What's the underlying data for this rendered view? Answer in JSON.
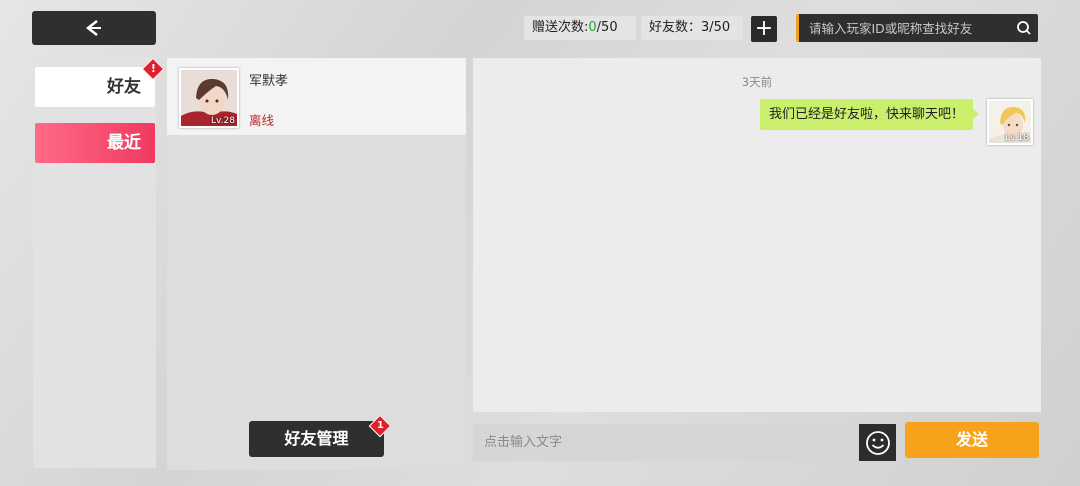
{
  "header": {
    "gift_label": "赠送次数:",
    "gift_used": "0",
    "gift_total": "/50",
    "friend_count": "好友数：3/50",
    "add_symbol": "+",
    "search_placeholder": "请输入玩家ID或昵称查找好友"
  },
  "tabs": {
    "friends_label": "好友",
    "recent_label": "最近",
    "friends_badge": "!"
  },
  "friend_list": [
    {
      "name": "军默孝",
      "status": "离线",
      "level": "Lv.28"
    }
  ],
  "manage": {
    "label": "好友管理",
    "badge": "1"
  },
  "chat": {
    "time_label": "3天前",
    "message": "我们已经是好友啦，快来聊天吧！",
    "self_level": "Lv.18"
  },
  "input": {
    "placeholder": "点击输入文字",
    "send_label": "发送"
  },
  "colors": {
    "accent_pink": "#f03a60",
    "accent_orange": "#f7a21b",
    "bubble_green": "#c9ef6c",
    "offline_red": "#c0262b",
    "gift_green": "#29a329"
  }
}
